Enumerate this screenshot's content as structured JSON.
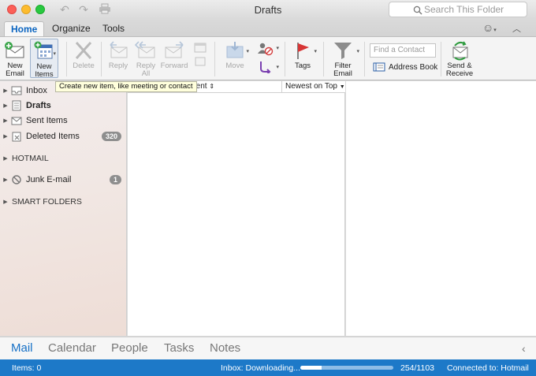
{
  "window": {
    "title": "Drafts"
  },
  "search": {
    "placeholder": "Search This Folder"
  },
  "tabs": [
    {
      "label": "Home",
      "active": true
    },
    {
      "label": "Organize",
      "active": false
    },
    {
      "label": "Tools",
      "active": false
    }
  ],
  "ribbon": {
    "new_email": "New\nEmail",
    "new_items": "New\nItems",
    "delete": "Delete",
    "reply": "Reply",
    "reply_all": "Reply\nAll",
    "forward": "Forward",
    "move": "Move",
    "tags": "Tags",
    "filter_email": "Filter\nEmail",
    "find_contact_placeholder": "Find a Contact",
    "address_book": "Address Book",
    "send_receive": "Send &\nReceive"
  },
  "tooltip": "Create new item, like meeting or contact",
  "sidebar": {
    "folders": [
      {
        "label": "Inbox",
        "badge": ""
      },
      {
        "label": "Drafts",
        "badge": ""
      },
      {
        "label": "Sent Items",
        "badge": ""
      },
      {
        "label": "Deleted Items",
        "badge": "320"
      }
    ],
    "hotmail": "HOTMAIL",
    "junk": {
      "label": "Junk E-mail",
      "badge": "1"
    },
    "smart_folders": "SMART FOLDERS"
  },
  "message_list": {
    "sort_field": "Sent",
    "sort_order": "Newest on Top"
  },
  "modules": [
    {
      "label": "Mail",
      "active": true
    },
    {
      "label": "Calendar",
      "active": false
    },
    {
      "label": "People",
      "active": false
    },
    {
      "label": "Tasks",
      "active": false
    },
    {
      "label": "Notes",
      "active": false
    }
  ],
  "status": {
    "items": "Items: 0",
    "download": "Inbox: Downloading...",
    "progress_fraction": 0.23,
    "count": "254/1103",
    "connection": "Connected to: Hotmail"
  },
  "colors": {
    "accent": "#1670c6",
    "statusbar": "#1d79c8"
  }
}
